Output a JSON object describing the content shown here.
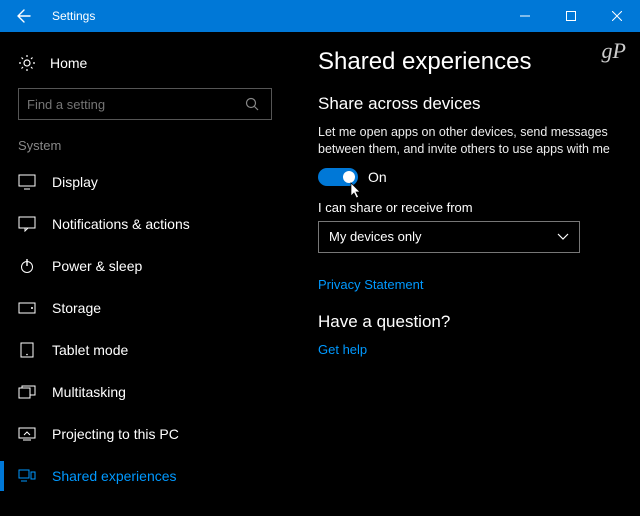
{
  "titlebar": {
    "title": "Settings"
  },
  "sidebar": {
    "home": "Home",
    "search_placeholder": "Find a setting",
    "category": "System",
    "items": [
      {
        "label": "Display"
      },
      {
        "label": "Notifications & actions"
      },
      {
        "label": "Power & sleep"
      },
      {
        "label": "Storage"
      },
      {
        "label": "Tablet mode"
      },
      {
        "label": "Multitasking"
      },
      {
        "label": "Projecting to this PC"
      },
      {
        "label": "Shared experiences"
      }
    ]
  },
  "content": {
    "watermark": "gP",
    "title": "Shared experiences",
    "share_section": "Share across devices",
    "share_desc": "Let me open apps on other devices, send messages between them, and invite others to use apps with me",
    "toggle_state": "On",
    "receive_label": "I can share or receive from",
    "dropdown_value": "My devices only",
    "privacy_link": "Privacy Statement",
    "question": "Have a question?",
    "help_link": "Get help"
  }
}
